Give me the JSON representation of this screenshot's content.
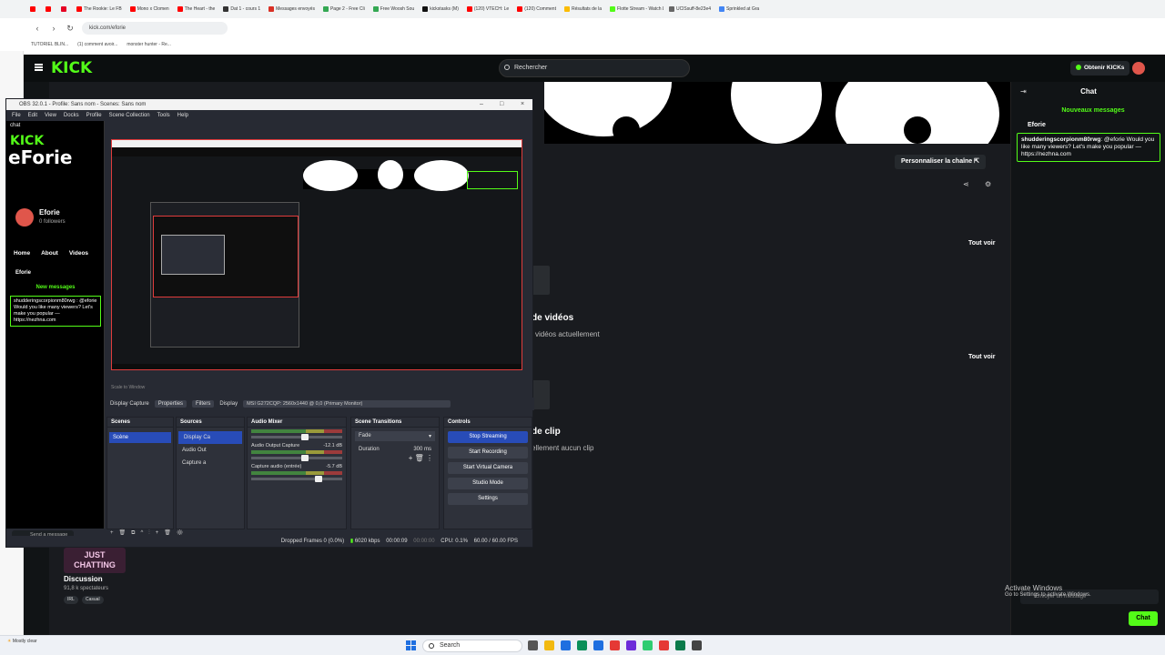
{
  "browser": {
    "tabs": [
      {
        "label": "",
        "color": "#ff0000"
      },
      {
        "label": "",
        "color": "#ff0000"
      },
      {
        "label": "",
        "color": "#e60023"
      },
      {
        "label": "The Rookie: Le FB",
        "color": "#ff0000"
      },
      {
        "label": "Mono x Clomen",
        "color": "#ff0000"
      },
      {
        "label": "The Heart - the",
        "color": "#ff0000"
      },
      {
        "label": "Dat 1 - cours 1",
        "color": "#333333"
      },
      {
        "label": "Messages envoyés",
        "color": "#d93025"
      },
      {
        "label": "Page 2 - Free Cli",
        "color": "#34a853"
      },
      {
        "label": "Free Woosh Sou",
        "color": "#34a853"
      },
      {
        "label": "kickstasks (M)",
        "color": "#111111"
      },
      {
        "label": "(120) VTECH: Le",
        "color": "#ff0000"
      },
      {
        "label": "(120) Comment",
        "color": "#ff0000"
      },
      {
        "label": "Résultats de la",
        "color": "#fbbc04"
      },
      {
        "label": "Flotte Stream - Watch Liv",
        "color": "#53fc18"
      },
      {
        "label": "UClSsuff-8e23e4",
        "color": "#666666"
      },
      {
        "label": "Sprinkled at Gra",
        "color": "#4285f4"
      }
    ],
    "url": "kick.com/eforie",
    "bookmarks": [
      "TUTORIEL BLIN...",
      "(1) comment avoir...",
      "monster hunter - Re..."
    ]
  },
  "kick": {
    "logo": "KICK",
    "search_placeholder": "Rechercher",
    "get_kicks_label": "Obtenir KICKs",
    "customize_label": "Personnaliser la chaîne",
    "see_all_1": "Tout voir",
    "see_all_2": "Tout voir",
    "videos_heading": "de vidéos",
    "videos_sub": "vidéos actuellement",
    "clips_heading": "de clip",
    "clips_sub": "ellement aucun clip",
    "category": {
      "art": "JUST CHATTING",
      "title": "Discussion",
      "viewers": "91,8 k spectateurs",
      "tags": [
        "IRL",
        "Casual"
      ]
    },
    "chat": {
      "title": "Chat",
      "new_messages": "Nouveaux messages",
      "user": "Eforie",
      "message_user": "shudderingscorpionm80rwg",
      "message_text": ": @eforie Would you like many viewers? Let's make you popular — https://nezhna.com",
      "input_placeholder": "Envoyer un message",
      "send_button": "Chat"
    }
  },
  "windows": {
    "activate_title": "Activate Windows",
    "activate_sub": "Go to Settings to activate Windows."
  },
  "obs": {
    "title": "OBS 32.0.1 - Profile: Sans nom - Scenes: Sans nom",
    "menu": [
      "File",
      "Edit",
      "View",
      "Docks",
      "Profile",
      "Scene Collection",
      "Tools",
      "Help"
    ],
    "left_panel": {
      "title": "chat",
      "logo": "KICK",
      "big_text": "eForie",
      "name": "Eforie",
      "followers": "0 followers",
      "tabs": [
        "Home",
        "About",
        "Videos"
      ],
      "user": "Eforie",
      "new_messages": "New messages",
      "message": "shudderingscorpionm80rwg : @eforie Would you like many viewers? Let's make you popular — https://nezhna.com",
      "send_placeholder": "Send a message"
    },
    "scale": "Scale to Window",
    "source_toolbar": {
      "source": "Display Capture",
      "properties": "Properties",
      "filters": "Filters",
      "display_label": "Display",
      "display_value": "MSI G272CQP: 2560x1440 @ 0,0 (Primary Monitor)"
    },
    "docks": {
      "scenes": {
        "title": "Scenes",
        "items": [
          "Scène"
        ]
      },
      "sources": {
        "title": "Sources",
        "items": [
          "Display Ca",
          "Audio Out",
          "Capture a"
        ]
      },
      "mixer": {
        "title": "Audio Mixer",
        "channels": [
          {
            "name": "",
            "db": "",
            "level": 0.6
          },
          {
            "name": "Audio Output Capture",
            "db": "-12.1 dB",
            "level": 0.55
          },
          {
            "name": "Capture audio (entrée)",
            "db": "-5.7 dB",
            "level": 0.8
          }
        ]
      },
      "transitions": {
        "title": "Scene Transitions",
        "type": "Fade",
        "duration_label": "Duration",
        "duration_value": "300 ms"
      },
      "controls": {
        "title": "Controls",
        "buttons": [
          "Stop Streaming",
          "Start Recording",
          "Start Virtual Camera",
          "Studio Mode",
          "Settings"
        ]
      }
    },
    "status": {
      "dropped": "Dropped Frames 0 (0.0%)",
      "bitrate": "6020 kbps",
      "stream_time": "00:00:09",
      "rec_time": "00:00:00",
      "cpu": "CPU: 0.1%",
      "fps": "60.00 / 60.00 FPS"
    }
  },
  "taskbar": {
    "search_label": "Search",
    "weather": "Mostly clear",
    "time": "",
    "date": ""
  }
}
